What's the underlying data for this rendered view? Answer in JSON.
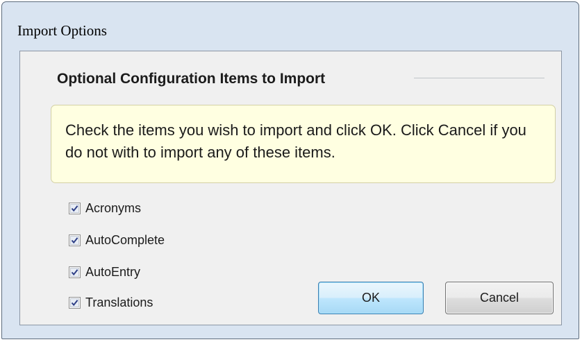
{
  "window": {
    "title": "Import Options"
  },
  "group": {
    "heading": "Optional Configuration Items to Import"
  },
  "info": {
    "text": "Check the items you wish to import and click OK. Click Cancel if you do not with to import any of these items."
  },
  "items": [
    {
      "label": "Acronyms",
      "checked": true
    },
    {
      "label": "AutoComplete",
      "checked": true
    },
    {
      "label": "AutoEntry",
      "checked": true
    },
    {
      "label": "Translations",
      "checked": true
    }
  ],
  "buttons": {
    "ok_label": "OK",
    "cancel_label": "Cancel"
  },
  "colors": {
    "info_background": "#ffffe1",
    "check_mark": "#2e3f86",
    "ok_border": "#3c7fb1"
  }
}
